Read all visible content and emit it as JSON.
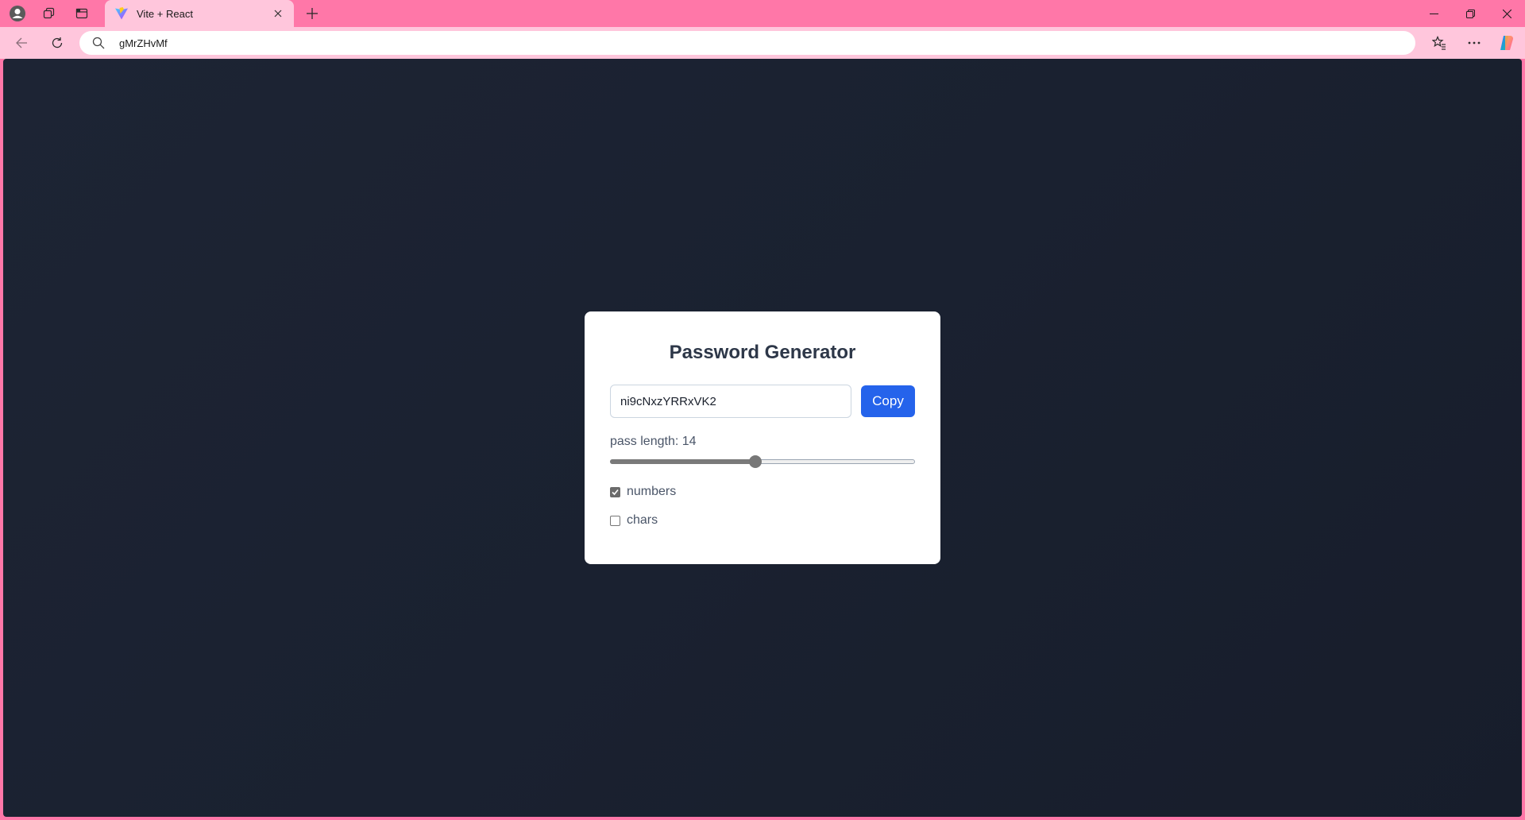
{
  "browser": {
    "tab": {
      "title": "Vite + React",
      "favicon": "vite-logo"
    },
    "address": {
      "value": "gMrZHvMf"
    },
    "icons": {
      "profile": "profile-icon",
      "workspaces": "workspaces-icon",
      "vertical_tabs": "vertical-tabs-icon",
      "new_tab": "plus-icon",
      "back": "back-arrow-icon",
      "refresh": "refresh-icon",
      "search": "search-icon",
      "favorites": "favorites-star-icon",
      "more": "more-ellipsis-icon",
      "copilot": "copilot-icon",
      "minimize": "minimize-icon",
      "restore": "restore-icon",
      "close": "close-icon"
    },
    "colors": {
      "frame": "#ff77a8",
      "toolbar": "#ffc6dc"
    }
  },
  "app": {
    "title": "Password Generator",
    "password": "ni9cNxzYRRxVK2",
    "copy_label": "Copy",
    "length_label": "pass length: 14",
    "slider": {
      "value": 14,
      "fraction": 0.477
    },
    "options": [
      {
        "label": "numbers",
        "checked": true
      },
      {
        "label": "chars",
        "checked": false
      }
    ],
    "colors": {
      "background": "#1a2130",
      "accent": "#2563eb",
      "card": "#ffffff"
    }
  }
}
